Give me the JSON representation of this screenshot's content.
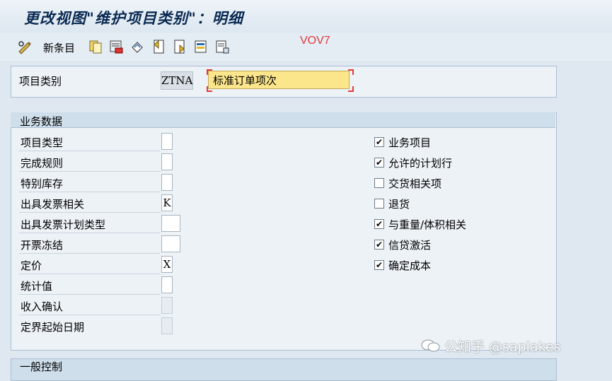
{
  "window": {
    "title": "更改视图\"维护项目类别\"：明细"
  },
  "toolbar": {
    "new_entries_label": "新条目",
    "icons": [
      "edit-glasses-icon",
      "copy-icon",
      "delete-icon",
      "undo-change-icon",
      "previous-entry-icon",
      "next-entry-icon",
      "select-all-icon",
      "print-icon"
    ],
    "transaction_code": "VOV7"
  },
  "key": {
    "label": "项目类别",
    "code": "ZTNA",
    "description": "标准订单项次"
  },
  "business_data": {
    "title": "业务数据",
    "fields": [
      {
        "label": "项目类型",
        "value": ""
      },
      {
        "label": "完成规则",
        "value": ""
      },
      {
        "label": "特别库存",
        "value": ""
      },
      {
        "label": "出具发票相关",
        "value": "K"
      },
      {
        "label": "出具发票计划类型",
        "value": ""
      },
      {
        "label": "开票冻结",
        "value": ""
      },
      {
        "label": "定价",
        "value": "X"
      },
      {
        "label": "统计值",
        "value": ""
      },
      {
        "label": "收入确认",
        "value": ""
      },
      {
        "label": "定界起始日期",
        "value": ""
      }
    ],
    "checkboxes": [
      {
        "label": "业务项目",
        "checked": true
      },
      {
        "label": "允许的计划行",
        "checked": true
      },
      {
        "label": "交货相关项",
        "checked": false
      },
      {
        "label": "退货",
        "checked": false
      },
      {
        "label": "与重量/体积相关",
        "checked": true
      },
      {
        "label": "信贷激活",
        "checked": true
      },
      {
        "label": "确定成本",
        "checked": true
      }
    ]
  },
  "general_control": {
    "title": "一般控制"
  },
  "watermark": {
    "text": "公知乎 @saplakes"
  },
  "colors": {
    "accent_red": "#e23a3a",
    "highlight_yellow": "#fce68b",
    "panel_bg": "#edf2f7"
  }
}
